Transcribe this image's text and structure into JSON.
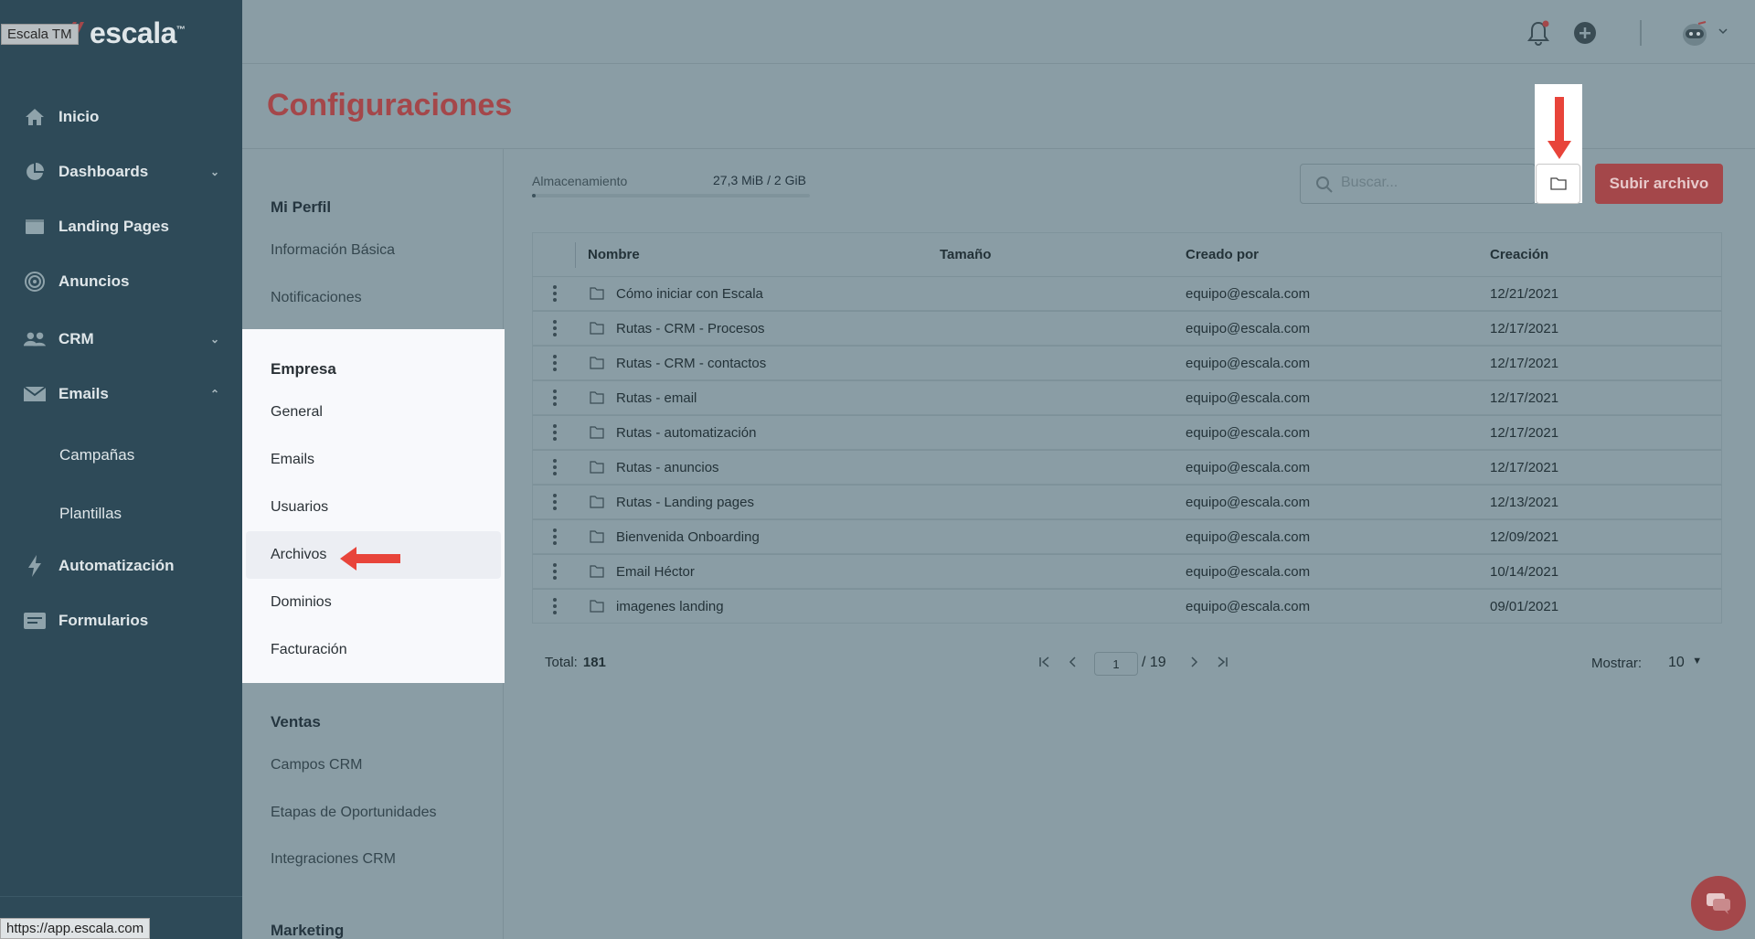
{
  "brand": {
    "name": "escala",
    "tm": "™",
    "tooltip": "Escala TM",
    "accent_color": "#a4474a",
    "sidebar_color": "#2e4a58"
  },
  "status_url": "https://app.escala.com",
  "sidebar": {
    "items": [
      {
        "label": "Inicio",
        "icon": "home-icon"
      },
      {
        "label": "Dashboards",
        "icon": "pie-chart-icon"
      },
      {
        "label": "Landing Pages",
        "icon": "browser-window-icon"
      },
      {
        "label": "Anuncios",
        "icon": "target-icon"
      },
      {
        "label": "CRM",
        "icon": "users-icon"
      },
      {
        "label": "Emails",
        "icon": "envelope-icon"
      },
      {
        "label": "Automatización",
        "icon": "lightning-icon"
      },
      {
        "label": "Formularios",
        "icon": "form-icon"
      }
    ],
    "email_subitems": [
      "Campañas",
      "Plantillas"
    ]
  },
  "page": {
    "title": "Configuraciones"
  },
  "settings_nav": {
    "mi_perfil": {
      "title": "Mi Perfil",
      "items": [
        "Información Básica",
        "Notificaciones"
      ]
    },
    "empresa": {
      "title": "Empresa",
      "items": [
        "General",
        "Emails",
        "Usuarios",
        "Archivos",
        "Dominios",
        "Facturación"
      ],
      "selected": "Archivos"
    },
    "ventas": {
      "title": "Ventas",
      "items": [
        "Campos CRM",
        "Etapas de Oportunidades",
        "Integraciones CRM"
      ]
    },
    "marketing": {
      "title": "Marketing"
    }
  },
  "storage": {
    "label": "Almacenamiento",
    "value": "27,3 MiB / 2 GiB",
    "fill_fraction": 0.013
  },
  "search": {
    "placeholder": "Buscar..."
  },
  "upload_button": "Subir archivo",
  "table": {
    "columns": [
      "Nombre",
      "Tamaño",
      "Creado por",
      "Creación"
    ],
    "rows": [
      {
        "name": "Cómo iniciar con Escala",
        "size": "",
        "creator": "equipo@escala.com",
        "date": "12/21/2021"
      },
      {
        "name": "Rutas - CRM - Procesos",
        "size": "",
        "creator": "equipo@escala.com",
        "date": "12/17/2021"
      },
      {
        "name": "Rutas - CRM - contactos",
        "size": "",
        "creator": "equipo@escala.com",
        "date": "12/17/2021"
      },
      {
        "name": "Rutas - email",
        "size": "",
        "creator": "equipo@escala.com",
        "date": "12/17/2021"
      },
      {
        "name": "Rutas - automatización",
        "size": "",
        "creator": "equipo@escala.com",
        "date": "12/17/2021"
      },
      {
        "name": "Rutas - anuncios",
        "size": "",
        "creator": "equipo@escala.com",
        "date": "12/17/2021"
      },
      {
        "name": "Rutas - Landing pages",
        "size": "",
        "creator": "equipo@escala.com",
        "date": "12/13/2021"
      },
      {
        "name": "Bienvenida Onboarding",
        "size": "",
        "creator": "equipo@escala.com",
        "date": "12/09/2021"
      },
      {
        "name": "Email Héctor",
        "size": "",
        "creator": "equipo@escala.com",
        "date": "10/14/2021"
      },
      {
        "name": "imagenes landing",
        "size": "",
        "creator": "equipo@escala.com",
        "date": "09/01/2021"
      }
    ]
  },
  "pagination": {
    "total_label": "Total:",
    "total_value": "181",
    "current_page": "1",
    "of_pages": "/ 19",
    "show_label": "Mostrar:",
    "show_value": "10"
  }
}
